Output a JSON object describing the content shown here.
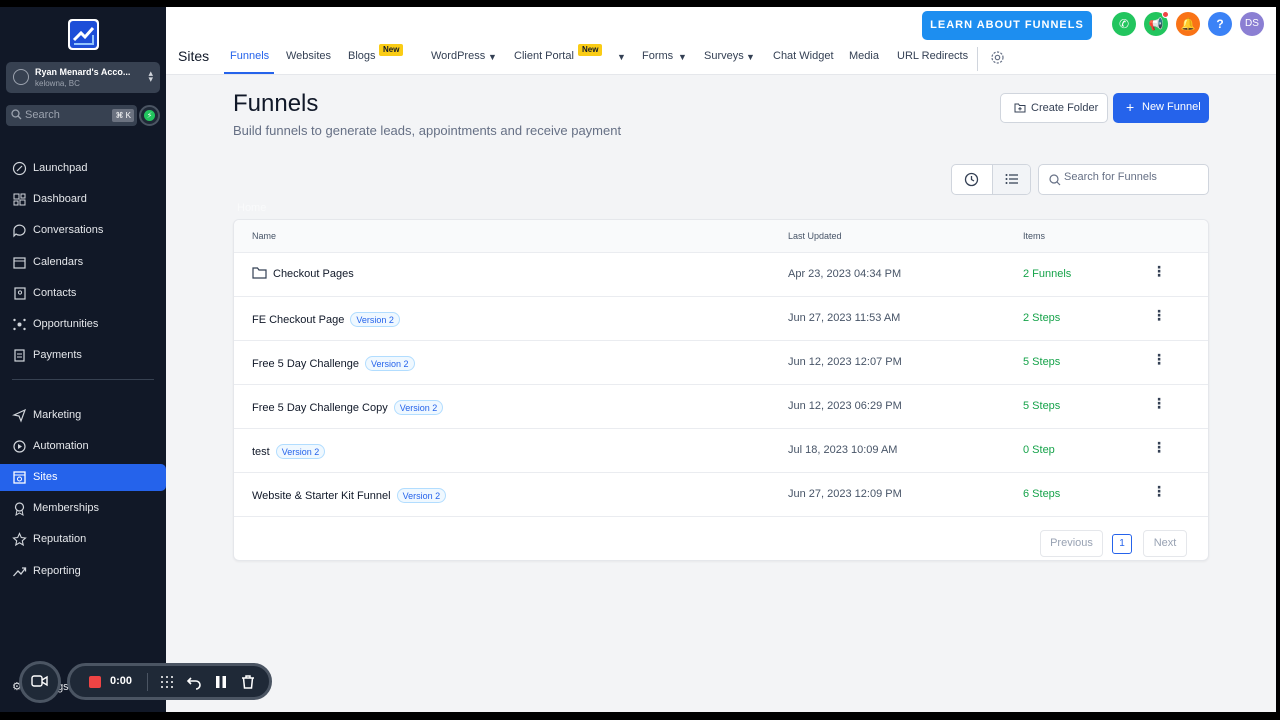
{
  "account": {
    "name": "Ryan Menard's Acco...",
    "location": "kelowna, BC"
  },
  "sidebar_search": {
    "placeholder": "Search",
    "shortcut": "⌘ K"
  },
  "nav": [
    {
      "label": "Launchpad",
      "icon": "rocket-icon"
    },
    {
      "label": "Dashboard",
      "icon": "dashboard-icon"
    },
    {
      "label": "Conversations",
      "icon": "chat-icon"
    },
    {
      "label": "Calendars",
      "icon": "calendar-icon"
    },
    {
      "label": "Contacts",
      "icon": "contacts-icon"
    },
    {
      "label": "Opportunities",
      "icon": "opportunities-icon"
    },
    {
      "label": "Payments",
      "icon": "payments-icon"
    },
    {
      "label": "Marketing",
      "icon": "send-icon"
    },
    {
      "label": "Automation",
      "icon": "automation-icon"
    },
    {
      "label": "Sites",
      "icon": "sites-icon",
      "active": true
    },
    {
      "label": "Memberships",
      "icon": "membership-icon"
    },
    {
      "label": "Reputation",
      "icon": "star-icon"
    },
    {
      "label": "Reporting",
      "icon": "chart-icon"
    }
  ],
  "settings_label": "Settings",
  "topbar": {
    "section": "Sites",
    "learn_button": "LEARN ABOUT FUNNELS",
    "avatar_initials": "DS",
    "new_badge": "New",
    "tabs": {
      "funnels": "Funnels",
      "websites": "Websites",
      "blogs": "Blogs",
      "wordpress": "WordPress",
      "client_portal": "Client Portal",
      "forms": "Forms",
      "surveys": "Surveys",
      "chat_widget": "Chat Widget",
      "media": "Media",
      "url_redirects": "URL Redirects"
    }
  },
  "page": {
    "title": "Funnels",
    "subtitle": "Build funnels to generate leads, appointments and receive payment",
    "create_folder": "Create Folder",
    "new_funnel": "New Funnel",
    "search_placeholder": "Search for Funnels",
    "breadcrumb": "Home"
  },
  "table": {
    "headers": {
      "name": "Name",
      "updated": "Last Updated",
      "items": "Items"
    },
    "rows": [
      {
        "name": "Checkout Pages",
        "folder": true,
        "version": "",
        "updated": "Apr 23, 2023 04:34 PM",
        "items": "2 Funnels"
      },
      {
        "name": "FE Checkout Page",
        "folder": false,
        "version": "Version 2",
        "updated": "Jun 27, 2023 11:53 AM",
        "items": "2 Steps"
      },
      {
        "name": "Free 5 Day Challenge",
        "folder": false,
        "version": "Version 2",
        "updated": "Jun 12, 2023 12:07 PM",
        "items": "5 Steps"
      },
      {
        "name": "Free 5 Day Challenge Copy",
        "folder": false,
        "version": "Version 2",
        "updated": "Jun 12, 2023 06:29 PM",
        "items": "5 Steps"
      },
      {
        "name": "test",
        "folder": false,
        "version": "Version 2",
        "updated": "Jul 18, 2023 10:09 AM",
        "items": "0 Step"
      },
      {
        "name": "Website & Starter Kit Funnel",
        "folder": false,
        "version": "Version 2",
        "updated": "Jun 27, 2023 12:09 PM",
        "items": "6 Steps"
      }
    ],
    "pagination": {
      "previous": "Previous",
      "current": "1",
      "next": "Next"
    }
  },
  "recorder": {
    "time": "0:00"
  },
  "colors": {
    "accent": "#2563eb",
    "sidebar": "#111827",
    "success": "#16a34a",
    "learn": "#1d8ef0"
  }
}
